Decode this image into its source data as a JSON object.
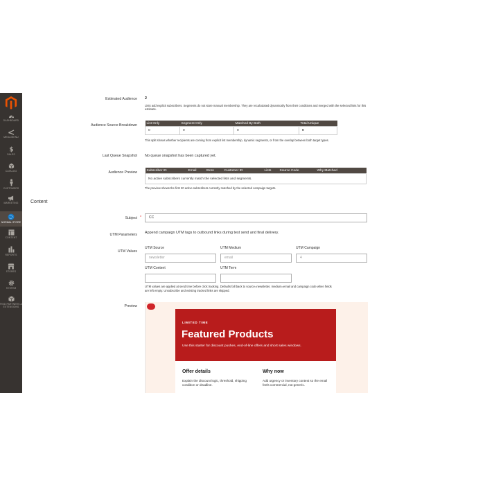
{
  "sidebar": {
    "items": [
      {
        "label": "DASHBOARD",
        "icon": "dashboard-icon"
      },
      {
        "label": "MEGA MENU",
        "icon": "mega-menu-icon"
      },
      {
        "label": "SALES",
        "icon": "dollar-icon"
      },
      {
        "label": "CATALOG",
        "icon": "cube-icon"
      },
      {
        "label": "CUSTOMERS",
        "icon": "person-icon"
      },
      {
        "label": "MARKETING",
        "icon": "megaphone-icon"
      },
      {
        "label": "NORMAL STORE",
        "icon": "globe-icon"
      },
      {
        "label": "CONTENT",
        "icon": "layout-icon"
      },
      {
        "label": "REPORTS",
        "icon": "bar-chart-icon"
      },
      {
        "label": "STORES",
        "icon": "store-icon"
      },
      {
        "label": "SYSTEM",
        "icon": "gear-icon"
      },
      {
        "label": "FIND PARTNERS & EXTENSIONS",
        "icon": "box-icon"
      }
    ]
  },
  "audience": {
    "estimated_label": "Estimated Audience",
    "estimated_value": "2",
    "estimated_note": "Lists add explicit subscribers. Segments do not store manual membership. They are recalculated dynamically from their conditions and merged with the selected lists for this estimate.",
    "breakdown_label": "Audience Source Breakdown",
    "breakdown_headers": [
      "List Only",
      "Segment Only",
      "Matched By Both",
      "Total Unique"
    ],
    "breakdown_values": [
      "0",
      "0",
      "0",
      "0"
    ],
    "breakdown_note": "This split shows whether recipients are coming from explicit list membership, dynamic segments, or from the overlap between both target types.",
    "snapshot_label": "Last Queue Snapshot",
    "snapshot_value": "No queue snapshot has been captured yet.",
    "preview_label": "Audience Preview",
    "preview_headers": [
      "Subscriber ID",
      "Email",
      "Store",
      "Customer ID",
      "Lists",
      "Source Code",
      "Why Matched"
    ],
    "preview_empty": "No active subscribers currently match the selected lists and segments.",
    "preview_note": "The preview shows the first 20 active subscribers currently matched by the selected campaign targets."
  },
  "content": {
    "section_title": "Content",
    "subject_label": "Subject",
    "required_mark": "*",
    "subject_value": "CC",
    "utm_params_label": "UTM Parameters",
    "utm_params_note": "Append campaign UTM tags to outbound links during test send and final delivery.",
    "utm_values_label": "UTM Values",
    "utm_source_label": "UTM Source",
    "utm_source_placeholder": "newsletter",
    "utm_medium_label": "UTM Medium",
    "utm_medium_placeholder": "email",
    "utm_campaign_label": "UTM Campaign",
    "utm_campaign_placeholder": "4",
    "utm_content_label": "UTM Content",
    "utm_term_label": "UTM Term",
    "utm_note_1": "UTM values are applied at send time before click tracking. Defaults fall back to source=newsletter, medium=email and campaign code when fields",
    "utm_note_2": "are left empty. Unsubscribe and existing tracked links are skipped.",
    "preview_label": "Preview"
  },
  "email_preview": {
    "eyebrow": "LIMITED TIME",
    "title": "Featured Products",
    "description": "Use this starter for discount pushes, end-of-line offers and short sales windows.",
    "col1_heading": "Offer details",
    "col1_text": "Explain the discount logic, threshold, shipping condition or deadline.",
    "col2_heading": "Why now",
    "col2_text": "Add urgency or inventory context so the email feels commercial, not generic.",
    "hero_color": "#b81c1c",
    "background_color": "#fdf1e9"
  },
  "colors": {
    "sidebar": "#373330",
    "sidebar_active": "#514943",
    "table_header": "#514943",
    "logo": "#eb5202"
  }
}
